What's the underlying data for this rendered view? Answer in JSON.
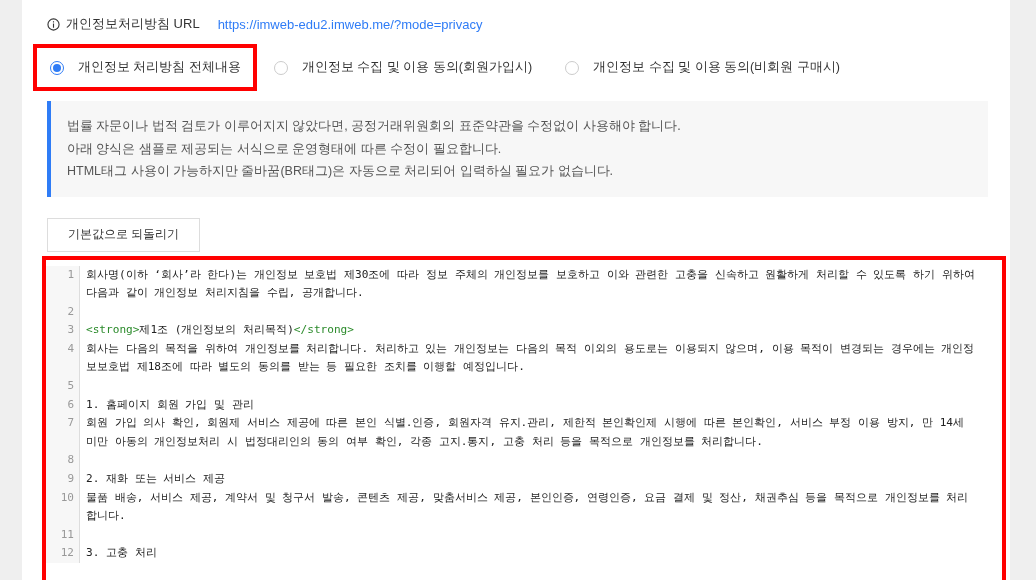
{
  "url_row": {
    "label": "개인정보처리방침 URL",
    "link": "https://imweb-edu2.imweb.me/?mode=privacy"
  },
  "options": [
    {
      "label": "개인정보 처리방침 전체내용",
      "selected": true,
      "highlighted": true
    },
    {
      "label": "개인정보 수집 및 이용 동의(회원가입시)",
      "selected": false,
      "highlighted": false
    },
    {
      "label": "개인정보 수집 및 이용 동의(비회원 구매시)",
      "selected": false,
      "highlighted": false
    }
  ],
  "notice": [
    "법률 자문이나 법적 검토가 이루어지지 않았다면, 공정거래위원회의 표준약관을 수정없이 사용해야 합니다.",
    "아래 양식은 샘플로 제공되는 서식으로 운영형태에 따른 수정이 필요합니다.",
    "HTML태그 사용이 가능하지만 줄바꿈(BR태그)은 자동으로 처리되어 입력하실 필요가 없습니다."
  ],
  "reset_button": "기본값으로 되돌리기",
  "editor": {
    "highlighted": true,
    "lines": [
      {
        "number": "1",
        "parts": [
          {
            "kind": "plain",
            "text": "회사명(이하 ‘회사’라 한다)는 개인정보 보호법 제30조에 따라 정보 주체의 개인정보를 보호하고 이와 관련한 고충을 신속하고 원활하게 처리할 수 있도록 하기 위하여 다음과 같이 개인정보 처리지침을 수립, 공개합니다."
          }
        ]
      },
      {
        "number": "2"
      },
      {
        "number": "3",
        "parts": [
          {
            "kind": "tag",
            "text": "<strong>"
          },
          {
            "kind": "plain",
            "text": "제1조 (개인정보의 처리목적)"
          },
          {
            "kind": "tag",
            "text": "</strong>"
          }
        ]
      },
      {
        "number": "4",
        "parts": [
          {
            "kind": "plain",
            "text": "회사는 다음의 목적을 위하여 개인정보를 처리합니다. 처리하고 있는 개인정보는 다음의 목적 이외의 용도로는 이용되지 않으며, 이용 목적이 변경되는 경우에는 개인정보보호법 제18조에 따라 별도의 동의를 받는 등 필요한 조치를 이행할 예정입니다."
          }
        ]
      },
      {
        "number": "5"
      },
      {
        "number": "6",
        "parts": [
          {
            "kind": "plain",
            "text": "1. 홈페이지 회원 가입 및 관리"
          }
        ]
      },
      {
        "number": "7",
        "parts": [
          {
            "kind": "plain",
            "text": "회원 가입 의사 확인, 회원제 서비스 제공에 따른 본인 식별.인증, 회원자격 유지.관리, 제한적 본인확인제 시행에 따른 본인확인, 서비스 부정 이용 방지, 만 14세 미만 아동의 개인정보처리 시 법정대리인의 동의 여부 확인, 각종 고지.통지, 고충 처리 등을 목적으로 개인정보를 처리합니다."
          }
        ]
      },
      {
        "number": "8"
      },
      {
        "number": "9",
        "parts": [
          {
            "kind": "plain",
            "text": "2. 재화 또는 서비스 제공"
          }
        ]
      },
      {
        "number": "10",
        "parts": [
          {
            "kind": "plain",
            "text": "물품 배송, 서비스 제공, 계약서 및 청구서 발송, 콘텐츠 제공, 맞춤서비스 제공, 본인인증, 연령인증, 요금 결제 및 정산, 채권추심 등을 목적으로 개인정보를 처리합니다."
          }
        ]
      },
      {
        "number": "11"
      },
      {
        "number": "12",
        "parts": [
          {
            "kind": "plain",
            "text": "3. 고충 처리"
          }
        ]
      }
    ]
  }
}
